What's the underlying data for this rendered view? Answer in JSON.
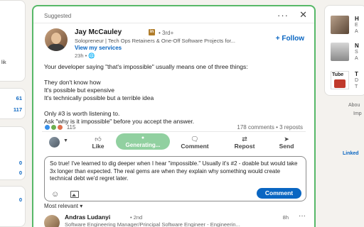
{
  "left": {
    "snippet": "lik",
    "stat1": "61",
    "stat2": "117",
    "stat3": "0",
    "stat4": "0",
    "stat5": "0"
  },
  "post": {
    "section_label": "Suggested",
    "author_name": "Jay McCauley",
    "author_badge": "in",
    "degree": "• 3rd+",
    "headline": "Solopreneur | Tech Ops Retainers & One-Off Software Projects for...",
    "services_link": "View my services",
    "time": "23h • 🌐",
    "follow_label": "+ Follow",
    "body_lines": [
      "Your developer saying \"that's impossible\" usually means one of three things:",
      "",
      "They don't know how",
      "It's possible but expensive",
      "It's technically possible but a terrible idea",
      "",
      "Only #3 is worth listening to.",
      "Ask \"why is it impossible\" before you accept the answer."
    ],
    "reaction_count": "115",
    "stats": "178 comments • 3 reposts"
  },
  "actions": {
    "like": "Like",
    "generating": "Generating...",
    "comment": "Comment",
    "repost": "Repost",
    "send": "Send"
  },
  "composer": {
    "text": "So true! I've learned to dig deeper when I hear \"impossible.\" Usually it's #2 - doable but would take 3x longer than expected. The real gems are when they explain why something would create technical debt we'd regret later.",
    "submit_label": "Comment"
  },
  "sort": {
    "label": "Most relevant ▾"
  },
  "comment": {
    "author": "Andras Ludanyi",
    "degree": "• 2nd",
    "headline": "Software Engineering Manager/Principal Software Engineer - Engineerin...",
    "time": "8h"
  },
  "right": {
    "item1_title": "H",
    "item1_sub1": "E",
    "item1_sub2": "A",
    "item2_title": "N",
    "item2_sub1": "S",
    "item2_sub2": "A",
    "item3_title": "T",
    "item3_sub1": "D",
    "item3_sub2": "T",
    "tube_label": "Tube",
    "about": "Abou",
    "imp": "Imp",
    "linked": "Linked"
  },
  "colors": {
    "accent": "#0a66c2",
    "focus_border": "#57b868",
    "generating_bg": "#91d0a0"
  },
  "icons": [
    "like-icon",
    "sparkle-icon",
    "comment-icon",
    "repost-icon",
    "send-icon",
    "emoji-icon",
    "image-icon",
    "more-icon",
    "close-icon",
    "globe-icon"
  ]
}
